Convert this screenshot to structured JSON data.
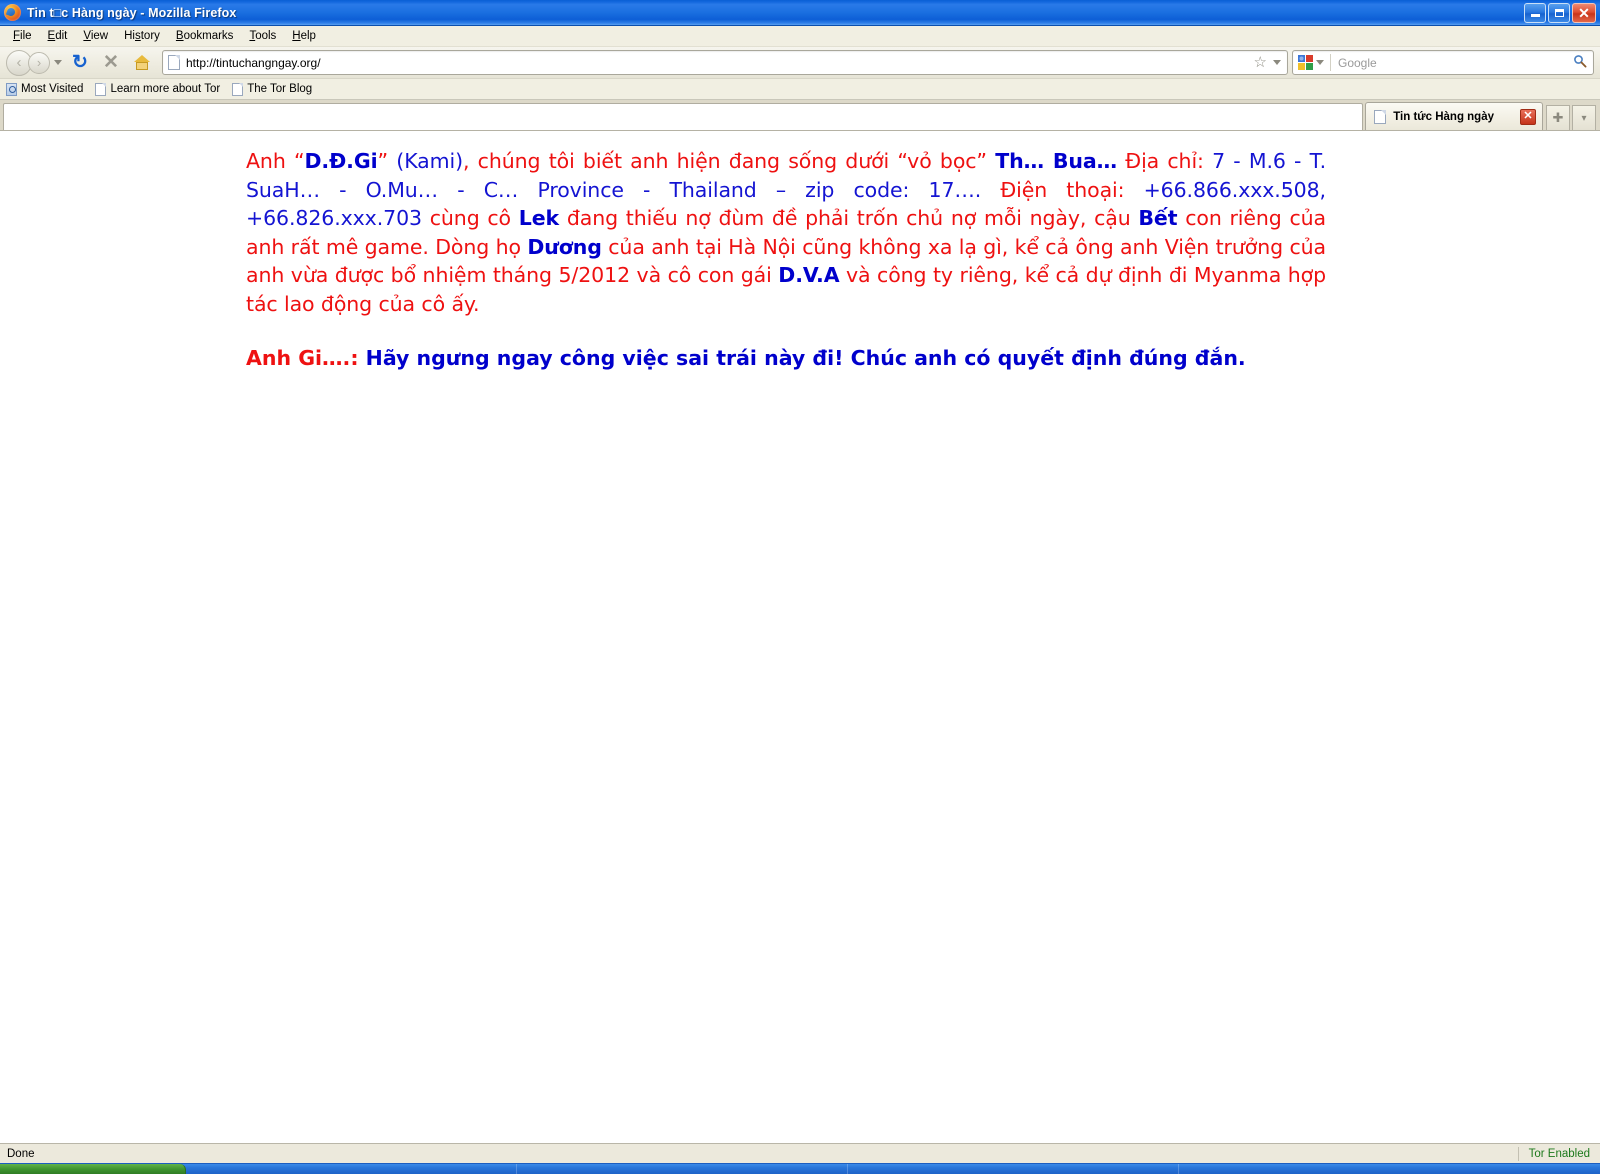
{
  "window": {
    "title": "Tin t□c Hàng ngày - Mozilla Firefox",
    "minimize_label": "Minimize",
    "maximize_label": "Maximize",
    "close_label": "Close"
  },
  "menubar": {
    "items": [
      {
        "label": "File",
        "accel": "F"
      },
      {
        "label": "Edit",
        "accel": "E"
      },
      {
        "label": "View",
        "accel": "V"
      },
      {
        "label": "History",
        "accel": "s"
      },
      {
        "label": "Bookmarks",
        "accel": "B"
      },
      {
        "label": "Tools",
        "accel": "T"
      },
      {
        "label": "Help",
        "accel": "H"
      }
    ]
  },
  "toolbar": {
    "back_glyph": "‹",
    "forward_glyph": "›",
    "reload_glyph": "↻",
    "stop_glyph": "✕",
    "home_label": "Home",
    "url": "http://tintuchangngay.org/",
    "star_glyph": "☆",
    "search_placeholder": "Google",
    "search_glyph": "🔍"
  },
  "bookmarks": {
    "items": [
      {
        "label": "Most Visited",
        "icon": "most-visited-icon"
      },
      {
        "label": "Learn more about Tor",
        "icon": "page-icon"
      },
      {
        "label": "The Tor Blog",
        "icon": "page-icon"
      }
    ]
  },
  "tabs": {
    "active": {
      "title": "Tin tức Hàng ngày",
      "close_glyph": "✕"
    },
    "new_tab_glyph": "✚",
    "tab_list_glyph": "▾"
  },
  "page": {
    "paragraph1": {
      "segments": [
        {
          "text": "Anh “",
          "style": "red"
        },
        {
          "text": "D.Đ.Gi",
          "style": "blue-bold"
        },
        {
          "text": "”",
          "style": "red"
        },
        {
          "text": " (Kami)",
          "style": "blue"
        },
        {
          "text": ", chúng tôi biết anh hiện đang sống dưới “vỏ bọc” ",
          "style": "red"
        },
        {
          "text": "Th… Bua…",
          "style": "blue-bold"
        },
        {
          "text": " Địa chỉ: ",
          "style": "red"
        },
        {
          "text": "7 - M.6 - T. SuaH… - O.Mu… - C… Province - Thailand – zip code: 17….",
          "style": "blue"
        },
        {
          "text": " Điện thoại: ",
          "style": "red"
        },
        {
          "text": "+66.866.xxx.508, +66.826.xxx.703",
          "style": "blue"
        },
        {
          "text": " cùng cô ",
          "style": "red"
        },
        {
          "text": "Lek",
          "style": "blue-bold"
        },
        {
          "text": " đang thiếu nợ đùm đề phải trốn chủ nợ mỗi ngày, cậu ",
          "style": "red"
        },
        {
          "text": "Bết",
          "style": "blue-bold"
        },
        {
          "text": " con riêng của anh rất mê game. Dòng họ ",
          "style": "red"
        },
        {
          "text": "Dương",
          "style": "blue-bold"
        },
        {
          "text": " của anh tại Hà Nội cũng không xa lạ gì, kể cả ông anh Viện trưởng của anh vừa được bổ nhiệm tháng 5/2012 và cô con gái ",
          "style": "red"
        },
        {
          "text": "D.V.A",
          "style": "blue-bold"
        },
        {
          "text": " và công ty riêng, kể cả dự định đi Myanma hợp tác lao động của cô ấy.",
          "style": "red"
        }
      ]
    },
    "paragraph2": {
      "segments": [
        {
          "text": "Anh Gi….:",
          "style": "red-bold"
        },
        {
          "text": " Hãy ngưng ngay công việc sai trái này đi! Chúc anh có quyết định đúng đắn.",
          "style": "blue-bold"
        }
      ]
    }
  },
  "statusbar": {
    "status": "Done",
    "tor": "Tor Enabled"
  },
  "colors": {
    "text_red": "#ee1111",
    "text_blue": "#0000cc",
    "link_blue": "#1414d2",
    "tor_green": "#1d7a1d",
    "title_bar": "#1a6fe0"
  }
}
